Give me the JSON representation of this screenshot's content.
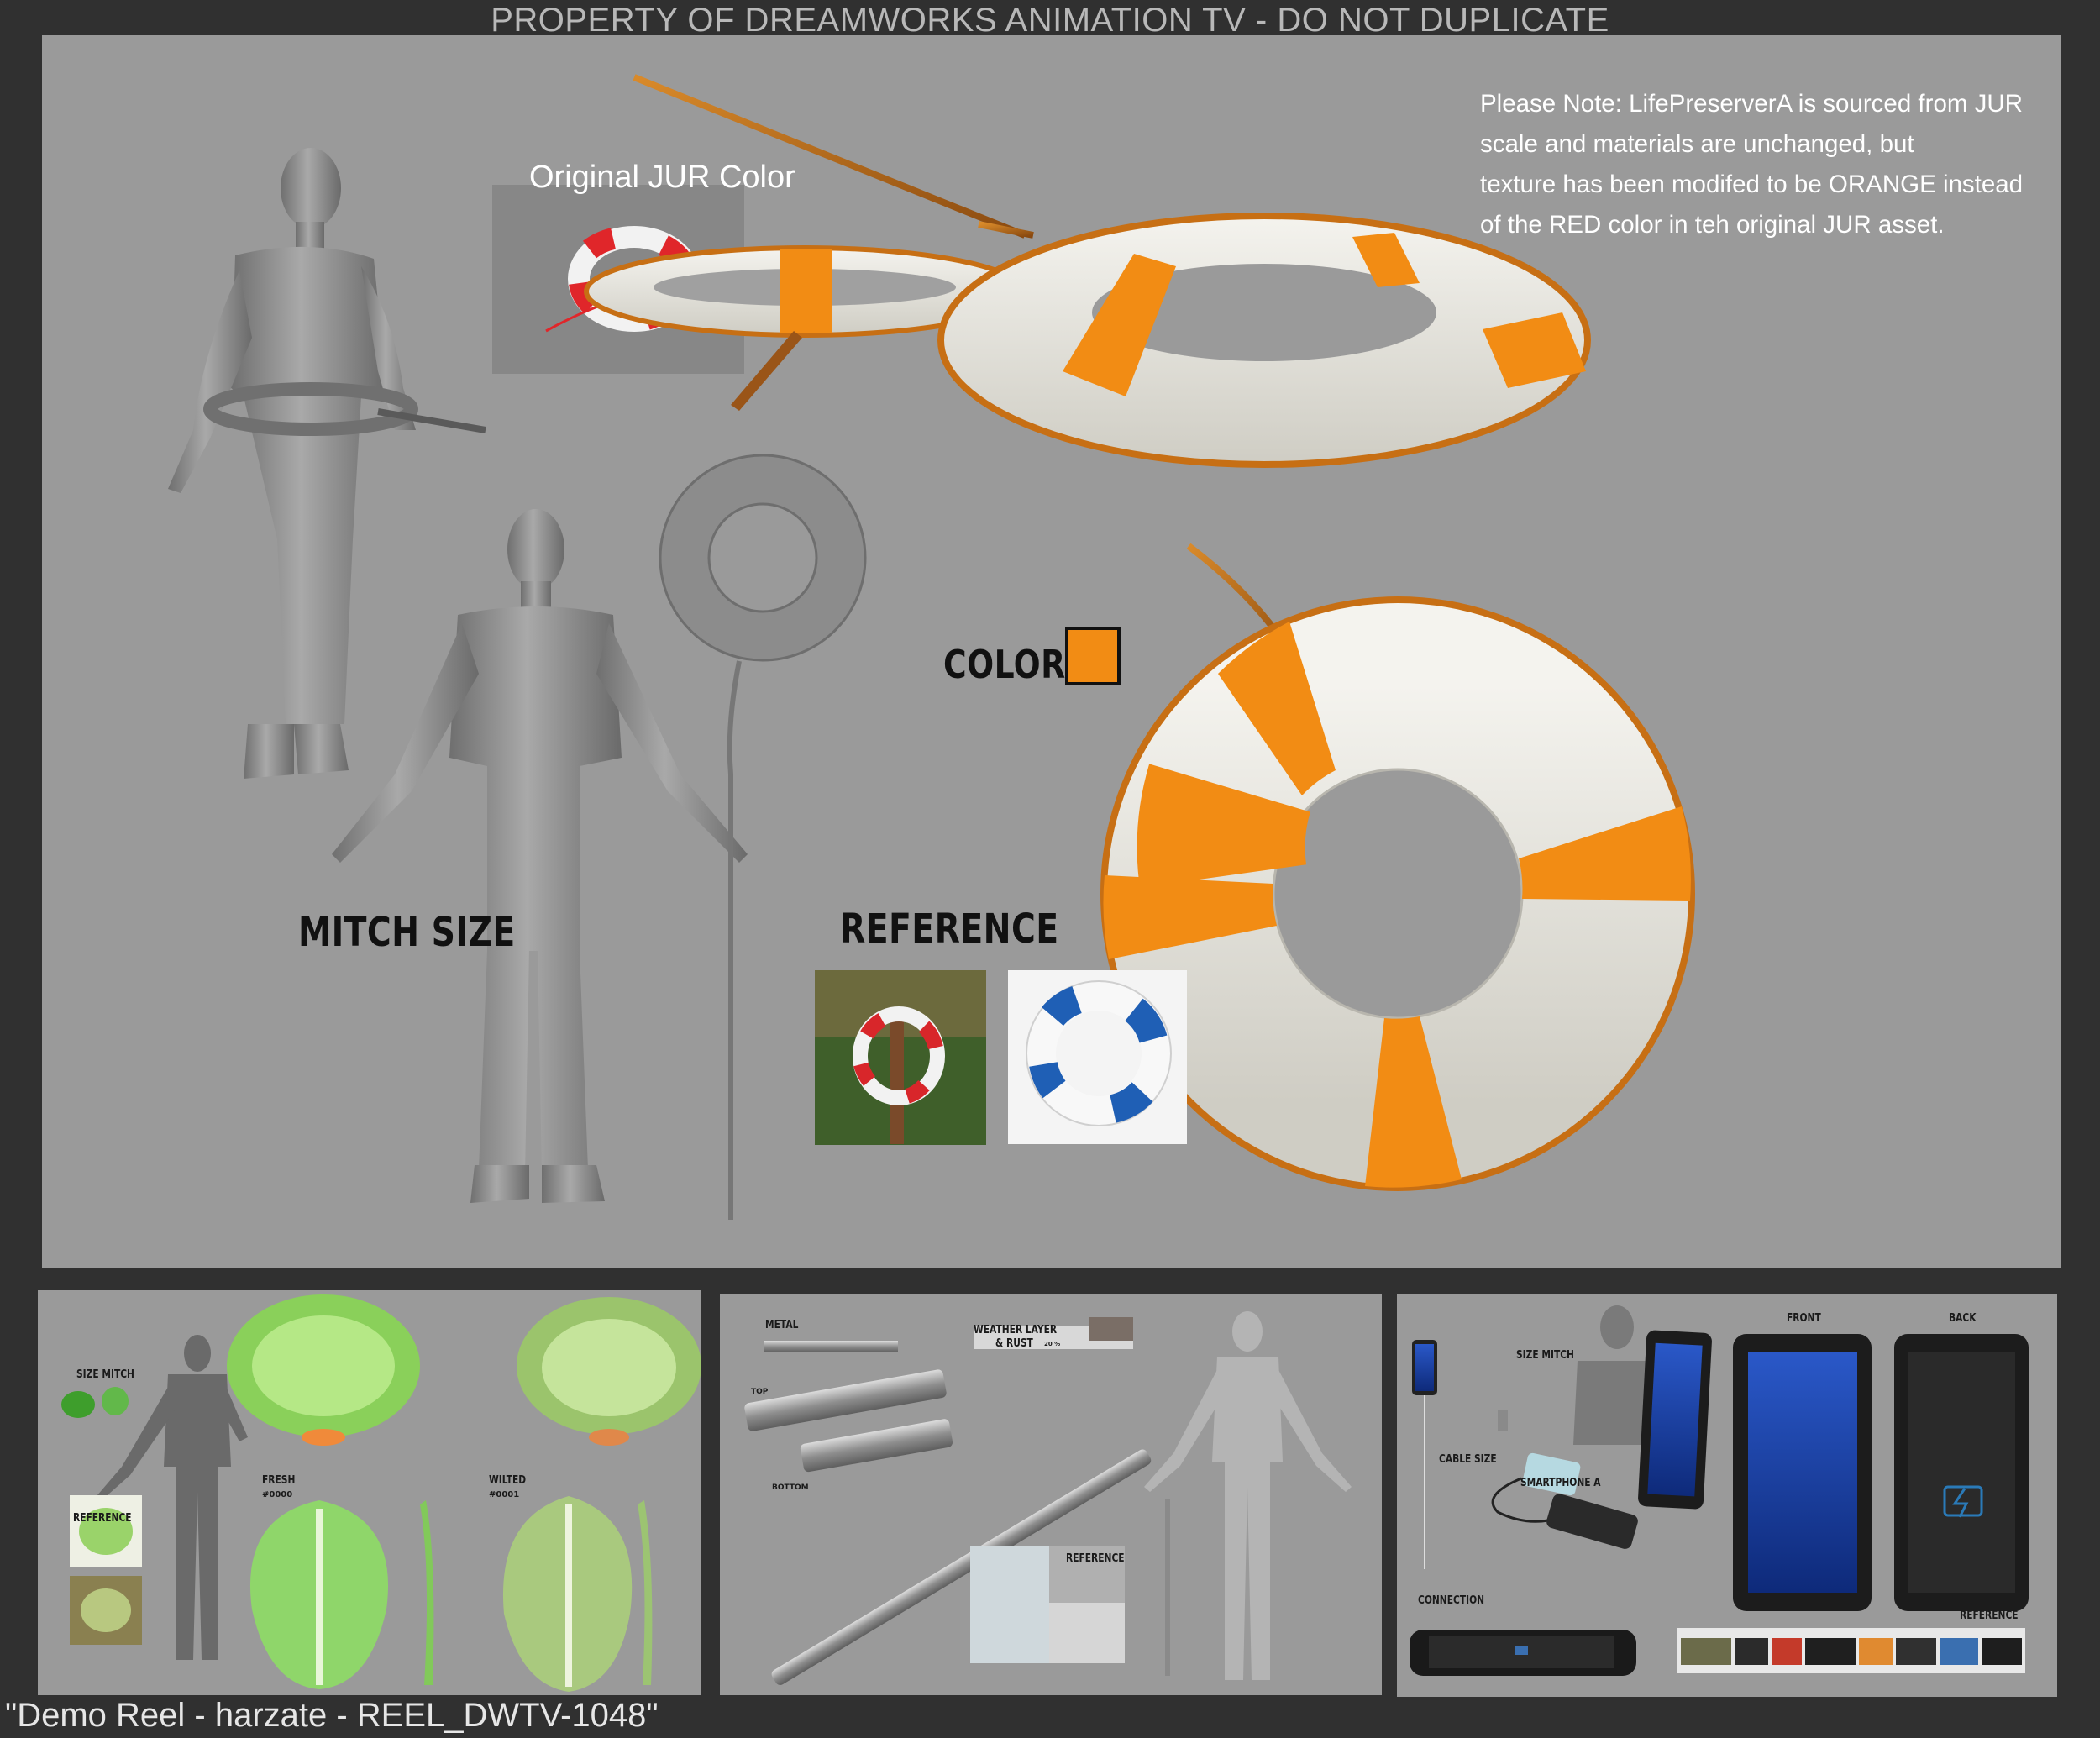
{
  "header": {
    "title": "PROPERTY OF DREAMWORKS ANIMATION TV - DO NOT DUPLICATE"
  },
  "footer": {
    "caption": "\"Demo Reel - harzate - REEL_DWTV-1048\""
  },
  "main_panel": {
    "original_color_title": "Original JUR Color",
    "note_lines": [
      "Please Note: LifePreserverA is sourced from JUR",
      "scale and materials are unchanged, but",
      "texture has been modifed to be ORANGE instead",
      "of the RED color in teh original JUR asset."
    ],
    "color_label": "COLOR",
    "swatch_color": "#f28c14",
    "mitch_size_label": "MITCH SIZE",
    "reference_label": "REFERENCE"
  },
  "lettuce_panel": {
    "size_mitch": "SIZE MITCH",
    "reference": "REFERENCE",
    "fresh": "FRESH",
    "fresh_code": "#0000",
    "wilted": "WILTED",
    "wilted_code": "#0001"
  },
  "pipe_panel": {
    "metal": "METAL",
    "top": "TOP",
    "bottom": "BOTTOM",
    "weather_layer": "WEATHER LAYER",
    "rust": "& RUST",
    "rust_pct": "20 %",
    "reference": "REFERENCE"
  },
  "power_panel": {
    "size_mitch": "SIZE MITCH",
    "cable_size": "CABLE SIZE",
    "smartphone": "SMARTPHONE A",
    "front": "FRONT",
    "back": "BACK",
    "connection": "CONNECTION",
    "reference": "REFERENCE"
  },
  "colors": {
    "orange": "#f28c14",
    "panel_gray": "#9a9a9a",
    "background": "#303030",
    "buoy_white": "#e9e7e0",
    "jur_red": "#e0262a",
    "ref_blue": "#1f5fb5"
  }
}
